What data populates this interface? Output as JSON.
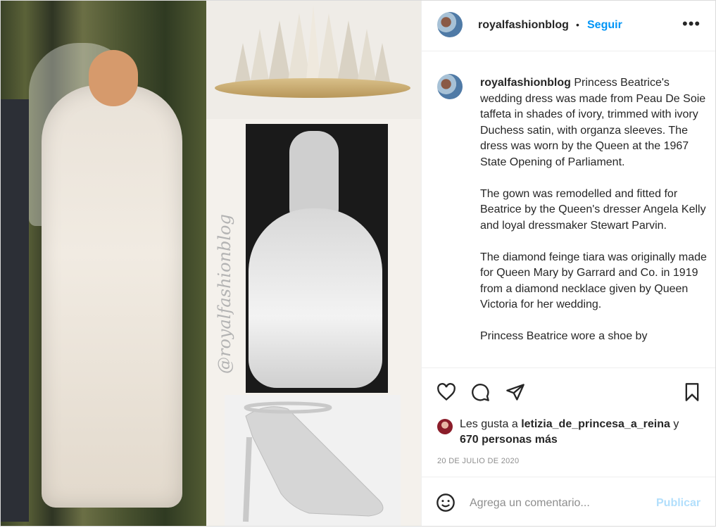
{
  "post": {
    "username": "royalfashionblog",
    "dot": "•",
    "follow_label": "Seguir",
    "more_label": "•••",
    "watermark": "@royalfashionblog",
    "caption_user": "royalfashionblog",
    "caption_paragraphs": [
      "Princess Beatrice's wedding dress was made from Peau De Soie taffeta in shades of ivory, trimmed with ivory Duchess satin, with organza sleeves. The dress was worn by the Queen at the 1967 State Opening of Parliament.",
      "The gown was remodelled and fitted for Beatrice by the Queen's dresser Angela Kelly and loyal dressmaker Stewart Parvin.",
      "The diamond feinge tiara was originally made for Queen Mary by Garrard and Co. in 1919 from a diamond necklace given by Queen Victoria for her wedding.",
      "Princess Beatrice wore a shoe by"
    ],
    "likes_prefix": "Les gusta a",
    "likes_user": "letizia_de_princesa_a_reina",
    "likes_and": "y",
    "likes_others": "670 personas más",
    "date": "20 DE JULIO DE 2020",
    "comment_placeholder": "Agrega un comentario...",
    "publish_label": "Publicar"
  },
  "icons": [
    "heart-icon",
    "comment-icon",
    "share-icon",
    "bookmark-icon",
    "emoji-icon",
    "more-options-icon"
  ]
}
